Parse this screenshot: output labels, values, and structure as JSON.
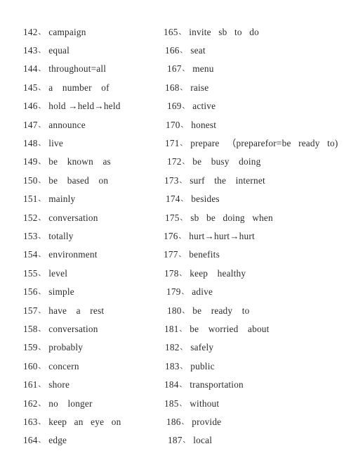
{
  "page": {
    "enumeration_mark": "、",
    "text_color": "#2b2b2b",
    "background_color": "#ffffff"
  },
  "columns": {
    "left": {
      "entries": [
        {
          "number": "142",
          "term": "campaign"
        },
        {
          "number": "143",
          "term": "equal"
        },
        {
          "number": "144",
          "term": "throughout=all"
        },
        {
          "number": "145",
          "term": "a number of"
        },
        {
          "number": "146",
          "term": "hold →held→held"
        },
        {
          "number": "147",
          "term": "announce"
        },
        {
          "number": "148",
          "term": "live"
        },
        {
          "number": "149",
          "term": "be known as"
        },
        {
          "number": "150",
          "term": "be based on"
        },
        {
          "number": "151",
          "term": "mainly"
        },
        {
          "number": "152",
          "term": "conversation"
        },
        {
          "number": "153",
          "term": "totally"
        },
        {
          "number": "154",
          "term": "environment"
        },
        {
          "number": "155",
          "term": "level"
        },
        {
          "number": "156",
          "term": "simple"
        },
        {
          "number": "157",
          "term": "have a rest"
        },
        {
          "number": "158",
          "term": "conversation"
        },
        {
          "number": "159",
          "term": "probably"
        },
        {
          "number": "160",
          "term": "concern"
        },
        {
          "number": "161",
          "term": "shore"
        },
        {
          "number": "162",
          "term": "no longer"
        },
        {
          "number": "163",
          "term": "keep an eye on"
        },
        {
          "number": "164",
          "term": "edge"
        }
      ]
    },
    "right": {
      "entries": [
        {
          "number": "165",
          "term": "invite sb to do"
        },
        {
          "number": "166",
          "term": "seat"
        },
        {
          "number": "167",
          "term": "menu"
        },
        {
          "number": "168",
          "term": "raise"
        },
        {
          "number": "169",
          "term": "active"
        },
        {
          "number": "170",
          "term": "honest"
        },
        {
          "number": "171",
          "term": "prepare （preparefor=be ready to)"
        },
        {
          "number": "172",
          "term": "be busy doing"
        },
        {
          "number": "173",
          "term": "surf the internet"
        },
        {
          "number": "174",
          "term": "besides"
        },
        {
          "number": "175",
          "term": "sb be doing when"
        },
        {
          "number": "176",
          "term": "hurt→hurt→hurt"
        },
        {
          "number": "177",
          "term": "benefits"
        },
        {
          "number": "178",
          "term": "keep healthy"
        },
        {
          "number": "179",
          "term": "adive"
        },
        {
          "number": "180",
          "term": "be ready to"
        },
        {
          "number": "181",
          "term": "be worried about"
        },
        {
          "number": "182",
          "term": "safely"
        },
        {
          "number": "183",
          "term": "public"
        },
        {
          "number": "184",
          "term": "transportation"
        },
        {
          "number": "185",
          "term": "without"
        },
        {
          "number": "186",
          "term": "provide"
        },
        {
          "number": "187",
          "term": "local"
        }
      ]
    }
  }
}
